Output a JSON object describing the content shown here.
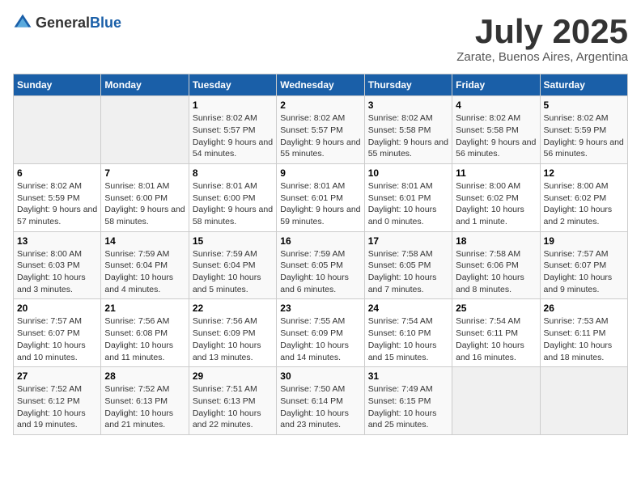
{
  "header": {
    "logo_general": "General",
    "logo_blue": "Blue",
    "title": "July 2025",
    "subtitle": "Zarate, Buenos Aires, Argentina"
  },
  "weekdays": [
    "Sunday",
    "Monday",
    "Tuesday",
    "Wednesday",
    "Thursday",
    "Friday",
    "Saturday"
  ],
  "weeks": [
    [
      {
        "day": null
      },
      {
        "day": null
      },
      {
        "day": "1",
        "sunrise": "Sunrise: 8:02 AM",
        "sunset": "Sunset: 5:57 PM",
        "daylight": "Daylight: 9 hours and 54 minutes."
      },
      {
        "day": "2",
        "sunrise": "Sunrise: 8:02 AM",
        "sunset": "Sunset: 5:57 PM",
        "daylight": "Daylight: 9 hours and 55 minutes."
      },
      {
        "day": "3",
        "sunrise": "Sunrise: 8:02 AM",
        "sunset": "Sunset: 5:58 PM",
        "daylight": "Daylight: 9 hours and 55 minutes."
      },
      {
        "day": "4",
        "sunrise": "Sunrise: 8:02 AM",
        "sunset": "Sunset: 5:58 PM",
        "daylight": "Daylight: 9 hours and 56 minutes."
      },
      {
        "day": "5",
        "sunrise": "Sunrise: 8:02 AM",
        "sunset": "Sunset: 5:59 PM",
        "daylight": "Daylight: 9 hours and 56 minutes."
      }
    ],
    [
      {
        "day": "6",
        "sunrise": "Sunrise: 8:02 AM",
        "sunset": "Sunset: 5:59 PM",
        "daylight": "Daylight: 9 hours and 57 minutes."
      },
      {
        "day": "7",
        "sunrise": "Sunrise: 8:01 AM",
        "sunset": "Sunset: 6:00 PM",
        "daylight": "Daylight: 9 hours and 58 minutes."
      },
      {
        "day": "8",
        "sunrise": "Sunrise: 8:01 AM",
        "sunset": "Sunset: 6:00 PM",
        "daylight": "Daylight: 9 hours and 58 minutes."
      },
      {
        "day": "9",
        "sunrise": "Sunrise: 8:01 AM",
        "sunset": "Sunset: 6:01 PM",
        "daylight": "Daylight: 9 hours and 59 minutes."
      },
      {
        "day": "10",
        "sunrise": "Sunrise: 8:01 AM",
        "sunset": "Sunset: 6:01 PM",
        "daylight": "Daylight: 10 hours and 0 minutes."
      },
      {
        "day": "11",
        "sunrise": "Sunrise: 8:00 AM",
        "sunset": "Sunset: 6:02 PM",
        "daylight": "Daylight: 10 hours and 1 minute."
      },
      {
        "day": "12",
        "sunrise": "Sunrise: 8:00 AM",
        "sunset": "Sunset: 6:02 PM",
        "daylight": "Daylight: 10 hours and 2 minutes."
      }
    ],
    [
      {
        "day": "13",
        "sunrise": "Sunrise: 8:00 AM",
        "sunset": "Sunset: 6:03 PM",
        "daylight": "Daylight: 10 hours and 3 minutes."
      },
      {
        "day": "14",
        "sunrise": "Sunrise: 7:59 AM",
        "sunset": "Sunset: 6:04 PM",
        "daylight": "Daylight: 10 hours and 4 minutes."
      },
      {
        "day": "15",
        "sunrise": "Sunrise: 7:59 AM",
        "sunset": "Sunset: 6:04 PM",
        "daylight": "Daylight: 10 hours and 5 minutes."
      },
      {
        "day": "16",
        "sunrise": "Sunrise: 7:59 AM",
        "sunset": "Sunset: 6:05 PM",
        "daylight": "Daylight: 10 hours and 6 minutes."
      },
      {
        "day": "17",
        "sunrise": "Sunrise: 7:58 AM",
        "sunset": "Sunset: 6:05 PM",
        "daylight": "Daylight: 10 hours and 7 minutes."
      },
      {
        "day": "18",
        "sunrise": "Sunrise: 7:58 AM",
        "sunset": "Sunset: 6:06 PM",
        "daylight": "Daylight: 10 hours and 8 minutes."
      },
      {
        "day": "19",
        "sunrise": "Sunrise: 7:57 AM",
        "sunset": "Sunset: 6:07 PM",
        "daylight": "Daylight: 10 hours and 9 minutes."
      }
    ],
    [
      {
        "day": "20",
        "sunrise": "Sunrise: 7:57 AM",
        "sunset": "Sunset: 6:07 PM",
        "daylight": "Daylight: 10 hours and 10 minutes."
      },
      {
        "day": "21",
        "sunrise": "Sunrise: 7:56 AM",
        "sunset": "Sunset: 6:08 PM",
        "daylight": "Daylight: 10 hours and 11 minutes."
      },
      {
        "day": "22",
        "sunrise": "Sunrise: 7:56 AM",
        "sunset": "Sunset: 6:09 PM",
        "daylight": "Daylight: 10 hours and 13 minutes."
      },
      {
        "day": "23",
        "sunrise": "Sunrise: 7:55 AM",
        "sunset": "Sunset: 6:09 PM",
        "daylight": "Daylight: 10 hours and 14 minutes."
      },
      {
        "day": "24",
        "sunrise": "Sunrise: 7:54 AM",
        "sunset": "Sunset: 6:10 PM",
        "daylight": "Daylight: 10 hours and 15 minutes."
      },
      {
        "day": "25",
        "sunrise": "Sunrise: 7:54 AM",
        "sunset": "Sunset: 6:11 PM",
        "daylight": "Daylight: 10 hours and 16 minutes."
      },
      {
        "day": "26",
        "sunrise": "Sunrise: 7:53 AM",
        "sunset": "Sunset: 6:11 PM",
        "daylight": "Daylight: 10 hours and 18 minutes."
      }
    ],
    [
      {
        "day": "27",
        "sunrise": "Sunrise: 7:52 AM",
        "sunset": "Sunset: 6:12 PM",
        "daylight": "Daylight: 10 hours and 19 minutes."
      },
      {
        "day": "28",
        "sunrise": "Sunrise: 7:52 AM",
        "sunset": "Sunset: 6:13 PM",
        "daylight": "Daylight: 10 hours and 21 minutes."
      },
      {
        "day": "29",
        "sunrise": "Sunrise: 7:51 AM",
        "sunset": "Sunset: 6:13 PM",
        "daylight": "Daylight: 10 hours and 22 minutes."
      },
      {
        "day": "30",
        "sunrise": "Sunrise: 7:50 AM",
        "sunset": "Sunset: 6:14 PM",
        "daylight": "Daylight: 10 hours and 23 minutes."
      },
      {
        "day": "31",
        "sunrise": "Sunrise: 7:49 AM",
        "sunset": "Sunset: 6:15 PM",
        "daylight": "Daylight: 10 hours and 25 minutes."
      },
      {
        "day": null
      },
      {
        "day": null
      }
    ]
  ]
}
